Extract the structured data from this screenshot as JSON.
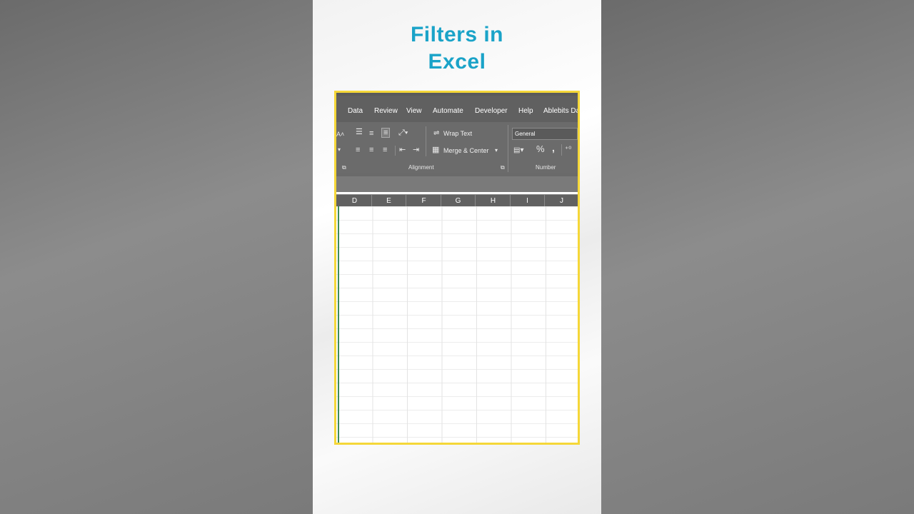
{
  "title": {
    "line1": "Filters in",
    "line2": "Excel"
  },
  "ribbon_tabs": [
    "Data",
    "Review",
    "View",
    "Automate",
    "Developer",
    "Help",
    "Ablebits Da"
  ],
  "alignment": {
    "wrap_text": "Wrap Text",
    "merge_center": "Merge & Center",
    "group_label": "Alignment"
  },
  "number": {
    "format_value": "General",
    "percent": "%",
    "comma": ",",
    "group_label": "Number"
  },
  "columns": [
    "D",
    "E",
    "F",
    "G",
    "H",
    "I",
    "J"
  ],
  "colors": {
    "title": "#1aa3c8",
    "frame_border": "#f5d738"
  }
}
